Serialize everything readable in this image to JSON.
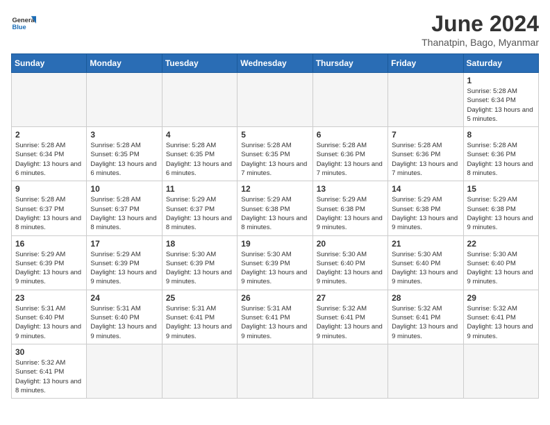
{
  "header": {
    "logo_general": "General",
    "logo_blue": "Blue",
    "title": "June 2024",
    "subtitle": "Thanatpin, Bago, Myanmar"
  },
  "weekdays": [
    "Sunday",
    "Monday",
    "Tuesday",
    "Wednesday",
    "Thursday",
    "Friday",
    "Saturday"
  ],
  "weeks": [
    [
      {
        "day": "",
        "info": ""
      },
      {
        "day": "",
        "info": ""
      },
      {
        "day": "",
        "info": ""
      },
      {
        "day": "",
        "info": ""
      },
      {
        "day": "",
        "info": ""
      },
      {
        "day": "",
        "info": ""
      },
      {
        "day": "1",
        "info": "Sunrise: 5:28 AM\nSunset: 6:34 PM\nDaylight: 13 hours and 5 minutes."
      }
    ],
    [
      {
        "day": "2",
        "info": "Sunrise: 5:28 AM\nSunset: 6:34 PM\nDaylight: 13 hours and 6 minutes."
      },
      {
        "day": "3",
        "info": "Sunrise: 5:28 AM\nSunset: 6:35 PM\nDaylight: 13 hours and 6 minutes."
      },
      {
        "day": "4",
        "info": "Sunrise: 5:28 AM\nSunset: 6:35 PM\nDaylight: 13 hours and 6 minutes."
      },
      {
        "day": "5",
        "info": "Sunrise: 5:28 AM\nSunset: 6:35 PM\nDaylight: 13 hours and 7 minutes."
      },
      {
        "day": "6",
        "info": "Sunrise: 5:28 AM\nSunset: 6:36 PM\nDaylight: 13 hours and 7 minutes."
      },
      {
        "day": "7",
        "info": "Sunrise: 5:28 AM\nSunset: 6:36 PM\nDaylight: 13 hours and 7 minutes."
      },
      {
        "day": "8",
        "info": "Sunrise: 5:28 AM\nSunset: 6:36 PM\nDaylight: 13 hours and 8 minutes."
      }
    ],
    [
      {
        "day": "9",
        "info": "Sunrise: 5:28 AM\nSunset: 6:37 PM\nDaylight: 13 hours and 8 minutes."
      },
      {
        "day": "10",
        "info": "Sunrise: 5:28 AM\nSunset: 6:37 PM\nDaylight: 13 hours and 8 minutes."
      },
      {
        "day": "11",
        "info": "Sunrise: 5:29 AM\nSunset: 6:37 PM\nDaylight: 13 hours and 8 minutes."
      },
      {
        "day": "12",
        "info": "Sunrise: 5:29 AM\nSunset: 6:38 PM\nDaylight: 13 hours and 8 minutes."
      },
      {
        "day": "13",
        "info": "Sunrise: 5:29 AM\nSunset: 6:38 PM\nDaylight: 13 hours and 9 minutes."
      },
      {
        "day": "14",
        "info": "Sunrise: 5:29 AM\nSunset: 6:38 PM\nDaylight: 13 hours and 9 minutes."
      },
      {
        "day": "15",
        "info": "Sunrise: 5:29 AM\nSunset: 6:38 PM\nDaylight: 13 hours and 9 minutes."
      }
    ],
    [
      {
        "day": "16",
        "info": "Sunrise: 5:29 AM\nSunset: 6:39 PM\nDaylight: 13 hours and 9 minutes."
      },
      {
        "day": "17",
        "info": "Sunrise: 5:29 AM\nSunset: 6:39 PM\nDaylight: 13 hours and 9 minutes."
      },
      {
        "day": "18",
        "info": "Sunrise: 5:30 AM\nSunset: 6:39 PM\nDaylight: 13 hours and 9 minutes."
      },
      {
        "day": "19",
        "info": "Sunrise: 5:30 AM\nSunset: 6:39 PM\nDaylight: 13 hours and 9 minutes."
      },
      {
        "day": "20",
        "info": "Sunrise: 5:30 AM\nSunset: 6:40 PM\nDaylight: 13 hours and 9 minutes."
      },
      {
        "day": "21",
        "info": "Sunrise: 5:30 AM\nSunset: 6:40 PM\nDaylight: 13 hours and 9 minutes."
      },
      {
        "day": "22",
        "info": "Sunrise: 5:30 AM\nSunset: 6:40 PM\nDaylight: 13 hours and 9 minutes."
      }
    ],
    [
      {
        "day": "23",
        "info": "Sunrise: 5:31 AM\nSunset: 6:40 PM\nDaylight: 13 hours and 9 minutes."
      },
      {
        "day": "24",
        "info": "Sunrise: 5:31 AM\nSunset: 6:40 PM\nDaylight: 13 hours and 9 minutes."
      },
      {
        "day": "25",
        "info": "Sunrise: 5:31 AM\nSunset: 6:41 PM\nDaylight: 13 hours and 9 minutes."
      },
      {
        "day": "26",
        "info": "Sunrise: 5:31 AM\nSunset: 6:41 PM\nDaylight: 13 hours and 9 minutes."
      },
      {
        "day": "27",
        "info": "Sunrise: 5:32 AM\nSunset: 6:41 PM\nDaylight: 13 hours and 9 minutes."
      },
      {
        "day": "28",
        "info": "Sunrise: 5:32 AM\nSunset: 6:41 PM\nDaylight: 13 hours and 9 minutes."
      },
      {
        "day": "29",
        "info": "Sunrise: 5:32 AM\nSunset: 6:41 PM\nDaylight: 13 hours and 9 minutes."
      }
    ],
    [
      {
        "day": "30",
        "info": "Sunrise: 5:32 AM\nSunset: 6:41 PM\nDaylight: 13 hours and 8 minutes."
      },
      {
        "day": "",
        "info": ""
      },
      {
        "day": "",
        "info": ""
      },
      {
        "day": "",
        "info": ""
      },
      {
        "day": "",
        "info": ""
      },
      {
        "day": "",
        "info": ""
      },
      {
        "day": "",
        "info": ""
      }
    ]
  ]
}
